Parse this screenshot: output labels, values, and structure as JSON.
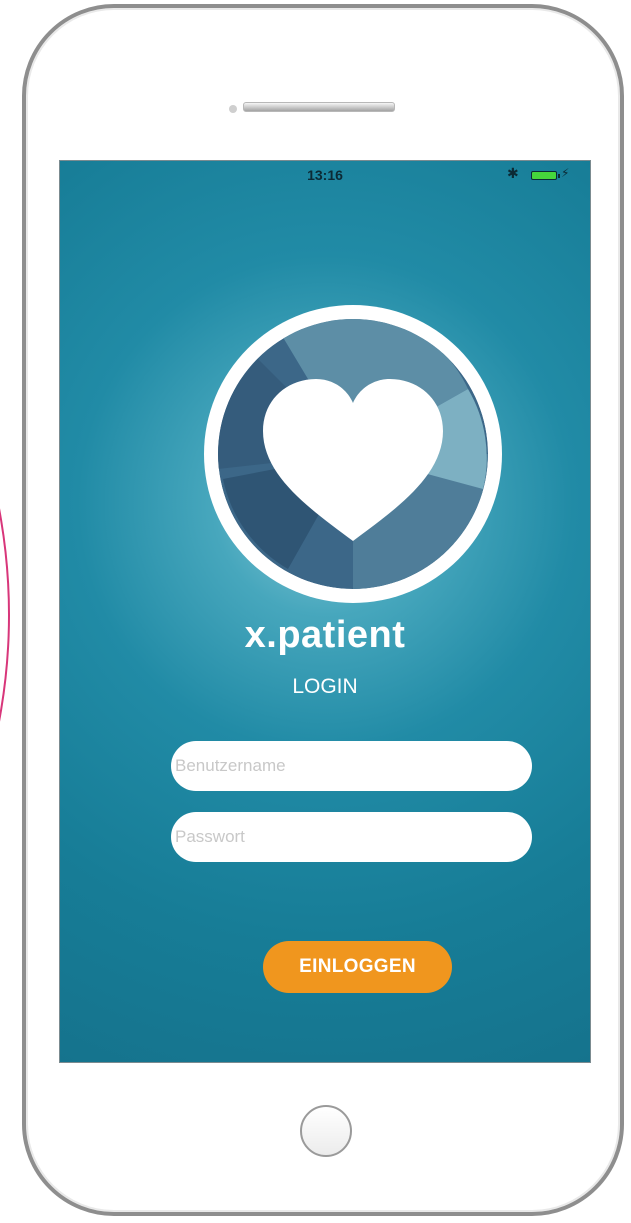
{
  "status_bar": {
    "time": "13:16",
    "bluetooth_icon": "bluetooth-icon",
    "battery_icon": "battery-icon",
    "charging_icon": "lightning-icon"
  },
  "logo": {
    "icon": "heart-icon",
    "colors": {
      "ring": "#ffffff",
      "dark_swirl": "#3c6788",
      "mid_swirl": "#5d8ea6",
      "light_swirl": "#8dbccb",
      "heart": "#ffffff"
    }
  },
  "brand": {
    "name": "x.patient"
  },
  "login": {
    "heading": "LOGIN",
    "username_placeholder": "Benutzername",
    "password_placeholder": "Passwort",
    "submit_label": "EINLOGGEN"
  },
  "colors": {
    "screen_background": "#1b829c",
    "button": "#f0961e",
    "accent_arc": "#d8367a"
  }
}
